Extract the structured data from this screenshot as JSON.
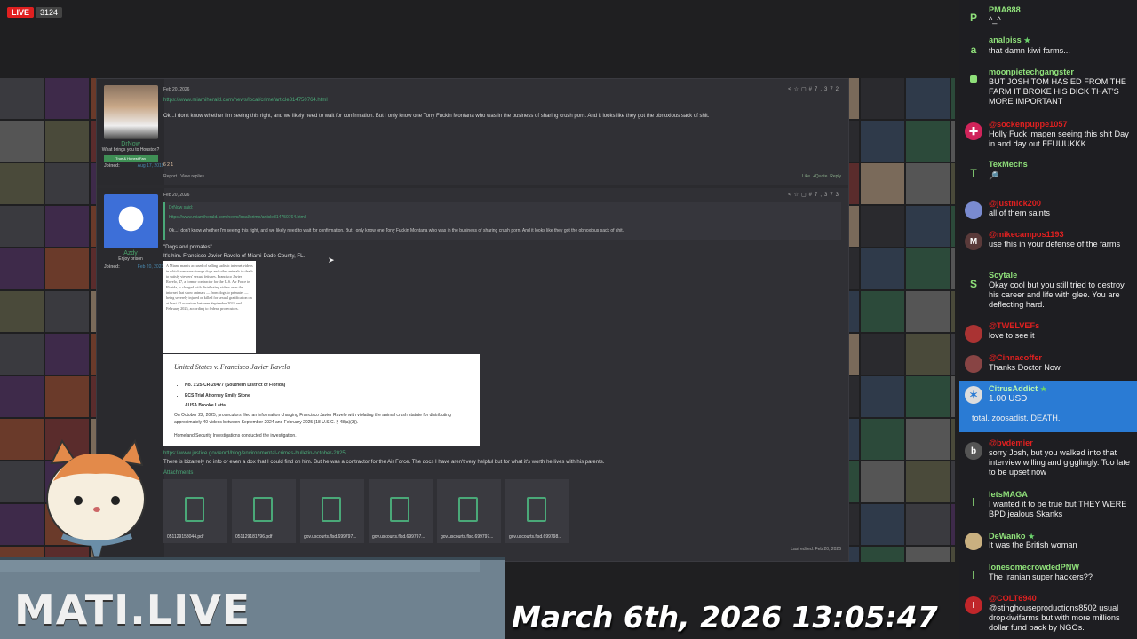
{
  "stream": {
    "live_label": "LIVE",
    "viewer_count": "3124",
    "brand": "MATI.LIVE",
    "timestamp": "March 6th, 2026 13:05:47"
  },
  "colors": {
    "live": "#e02020",
    "chat_highlight": "#2a7bd4",
    "forum_link": "#4aa878"
  },
  "posts": [
    {
      "user": "DrNow",
      "user_title": "What brings you to Houston?",
      "banner": "True & Honest Fan",
      "joined_label": "Joined:",
      "joined": "Aug 17, 2019",
      "date": "Feb 20, 2026",
      "number": "#7,372",
      "link": "https://www.miamiherald.com/news/local/crime/article314750764.html",
      "text": "Ok...I don't know whether I'm seeing this right, and we likely need to wait for confirmation. But I only know one Tony Fuckin Montana who was in the business of sharing crush porn. And it looks like they got the obnoxious sack of shit.",
      "reactions": "6  2  1",
      "report": "Report",
      "view_replies": "View replies",
      "like": "Like",
      "quote": "+Quote",
      "reply": "Reply"
    },
    {
      "user": "Azdy",
      "user_title": "Enjoy prison",
      "joined_label": "Joined:",
      "joined": "Feb 20, 2023",
      "date": "Feb 20, 2026",
      "number": "#7,373",
      "quote_author": "DrNow said:",
      "quote_link": "https://www.miamiherald.com/news/local/crime/article314750764.html",
      "quote_text": "Ok...I don't know whether I'm seeing this right, and we likely need to wait for confirmation. But I only know one Tony Fuckin Montana who was in the business of sharing crush porn. And it looks like they got the obnoxious sack of shit.",
      "line1": "\"Dogs and primates\"",
      "line2": "It's him. Francisco Javier Ravelo of Miami-Dade County, FL.",
      "clip_text": "A Miami man is accused of selling sadistic internet videos in which someone stomps dogs and other animals to death to satisfy viewers' sexual fetishes. Francisco Javier Ravelo, 47, a former contractor for the U.S. Air Force in Florida, is charged with distributing videos over the internet that show animals — from dogs to primates — being severely injured or killed for sexual gratification on at least 42 occasions between September 2024 and February 2025, according to federal prosecutors.",
      "doc_title": "United States v. Francisco Javier Ravelo",
      "doc_items": [
        "No. 1:25-CR-20477 (Southern District of Florida)",
        "ECS Trial Attorney Emily Stone",
        "AUSA Brooke Latta"
      ],
      "doc_text": "On October 22, 2025, prosecutors filed an information charging Francisco Javier Ravelo with violating the animal crush statute for distributing approximately 40 videos between September 2024 and February 2025 (18 U.S.C. § 48(a)(3)).",
      "doc_footer": "Homeland Security Investigations conducted the investigation.",
      "link2": "https://www.justice.gov/enrd/blog/environmental-crimes-bulletin-october-2025",
      "text2": "There is bizarrely no info or even a dox that I could find on him. But he was a contractor for the Air Force. The docs I have aren't very helpful but for what it's worth he lives with his parents.",
      "attachments_label": "Attachments",
      "attachments": [
        "051129158044.pdf",
        "051129181796.pdf",
        "gov.uscourts.flsd.699797...",
        "gov.uscourts.flsd.699797...",
        "gov.uscourts.flsd.699797...",
        "gov.uscourts.flsd.699798..."
      ],
      "last_edited": "Last edited: Feb 20, 2026"
    }
  ],
  "chat": [
    {
      "name": "PMA888",
      "text": "^_^",
      "avatar": "P",
      "color": "#8fe07a"
    },
    {
      "name": "analpiss",
      "text": "that damn kiwi farms...",
      "avatar": "a",
      "color": "#8fe07a"
    },
    {
      "name": "moonpietechgangster",
      "text": "BUT JOSH TOM HAS ED FROM THE FARM IT BROKE HIS DICK THAT'S MORE IMPORTANT",
      "avatar": "",
      "color": "#8fe07a"
    },
    {
      "name": "@sockenpuppe1057",
      "text": "Holly Fuck imagen seeing this shit Day in and day out FFUUUKKK",
      "avatar": "",
      "color": "#e02020"
    },
    {
      "name": "TexMechs",
      "text": "🔎",
      "avatar": "T",
      "color": "#8fe07a"
    },
    {
      "name": "@justnick200",
      "text": "all of them saints",
      "avatar": "",
      "color": "#e02020"
    },
    {
      "name": "@mikecampos1193",
      "text": "use this in your defense of the farms",
      "avatar": "M",
      "color": "#e02020"
    },
    {
      "name": "Scytale",
      "text": "Okay cool but you still tried to destroy his career and life with glee. You are deflecting hard.",
      "avatar": "S",
      "color": "#8fe07a"
    },
    {
      "name": "@TWELVEFs",
      "text": "love to see it",
      "avatar": "",
      "color": "#e02020"
    },
    {
      "name": "@Cinnacoffer",
      "text": "Thanks Doctor Now",
      "avatar": "",
      "color": "#e02020"
    },
    {
      "name": "CitrusAddict",
      "amount": "1.00 USD",
      "text": "total. zoosadist. DEATH.",
      "avatar": "",
      "color": "#8fe07a"
    },
    {
      "name": "@bvdemier",
      "text": "sorry Josh, but you walked into that interview willing and gigglingly. Too late to be upset now",
      "avatar": "b",
      "color": "#e02020"
    },
    {
      "name": "letsMAGA",
      "text": "I wanted it to be true but THEY WERE BPD jealous Skanks",
      "avatar": "l",
      "color": "#8fe07a"
    },
    {
      "name": "DeWanko",
      "text": "It was the British woman",
      "avatar": "",
      "color": "#8fe07a"
    },
    {
      "name": "lonesomecrowdedPNW",
      "text": "The Iranian super hackers??",
      "avatar": "l",
      "color": "#8fe07a"
    },
    {
      "name": "@COLT6940",
      "text": "@stinghouseproductions8502 usual dropkiwifarms but with more millions dollar fund back by NGOs.",
      "avatar": "I",
      "color": "#e02020"
    }
  ]
}
